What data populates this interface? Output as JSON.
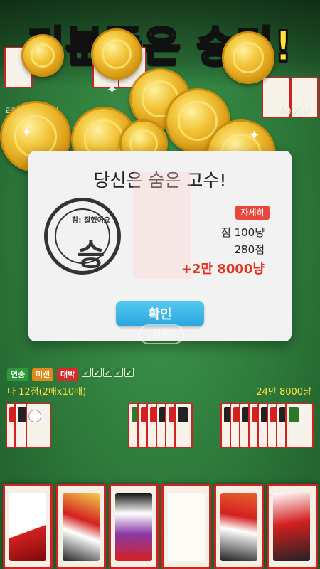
{
  "banner": {
    "title_part1": "기분좋은",
    "title_part2": "승리!",
    "accent_color": "#ffe23a"
  },
  "opponent": {
    "level_label": "레벨 32",
    "score_label": "0점",
    "money_label": "4000냥"
  },
  "result_dialog": {
    "title": "당신은 숨은 고수!",
    "stamp_text_arc": "참! 잘했어요",
    "stamp_glyph": "승",
    "detail_button": "자세히",
    "points_line": "점 100냥",
    "score_line": "280점",
    "reward_line": "+2만 8000냥",
    "confirm_button": "확인",
    "reward_color": "#e53222",
    "confirm_color": "#2aa6de"
  },
  "auto_button": "자동",
  "player": {
    "badges": [
      {
        "label": "연승",
        "color": "#2e9b3a"
      },
      {
        "label": "미션",
        "color": "#e08a1a"
      },
      {
        "label": "대박",
        "color": "#d42b2b"
      }
    ],
    "check_icon": "check-icon",
    "score_label": "나 12점(2배x10배)",
    "money_label": "24만 8000냥"
  }
}
